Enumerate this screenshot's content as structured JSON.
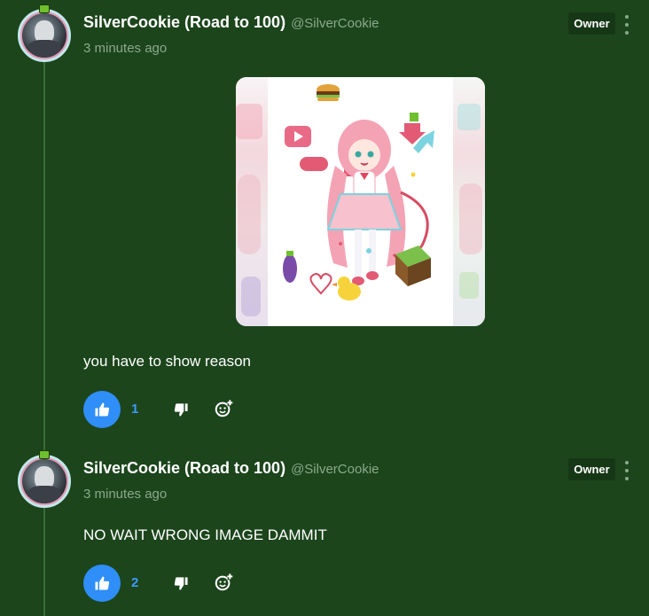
{
  "comments": [
    {
      "author": "SilverCookie (Road to 100)",
      "handle": "@SilverCookie",
      "time": "3 minutes ago",
      "badge": "Owner",
      "text": "you have to show reason",
      "likes": "1",
      "has_image": true
    },
    {
      "author": "SilverCookie (Road to 100)",
      "handle": "@SilverCookie",
      "time": "3 minutes ago",
      "badge": "Owner",
      "text": "NO WAIT WRONG IMAGE DAMMIT",
      "likes": "2",
      "has_image": false
    }
  ],
  "icons": {
    "like": "thumbs-up-icon",
    "dislike": "thumbs-down-icon",
    "react": "add-reaction-icon",
    "more": "more-vertical-icon"
  },
  "colors": {
    "background": "#1c451c",
    "like_button": "#2f8ef7",
    "like_count": "#3d98ff",
    "muted_text": "#8aa98a",
    "badge_bg": "#163716"
  }
}
